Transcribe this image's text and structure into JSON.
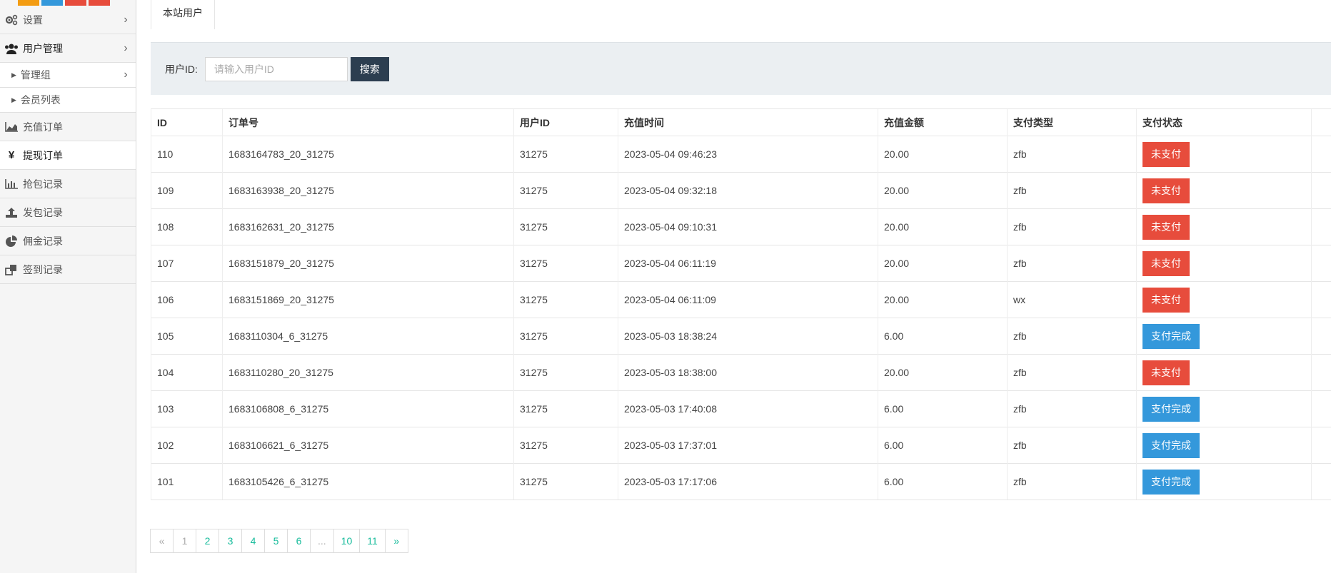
{
  "sidebar": {
    "top_colors": [
      "#f39c12",
      "#3498db",
      "#e74c3c",
      "#e74c3c"
    ],
    "items": [
      {
        "label": "设置",
        "icon": "gears-icon"
      },
      {
        "label": "用户管理",
        "icon": "users-icon"
      },
      {
        "label": "管理组"
      },
      {
        "label": "会员列表"
      },
      {
        "label": "充值订单",
        "icon": "area-chart-icon"
      },
      {
        "label": "提现订单",
        "icon": "yen-icon"
      },
      {
        "label": "抢包记录",
        "icon": "bar-chart-icon"
      },
      {
        "label": "发包记录",
        "icon": "upload-icon"
      },
      {
        "label": "佣金记录",
        "icon": "pie-chart-icon"
      },
      {
        "label": "签到记录",
        "icon": "clone-icon"
      }
    ]
  },
  "tab": {
    "label": "本站用户"
  },
  "filter": {
    "label": "用户ID:",
    "placeholder": "请输入用户ID",
    "search_label": "搜索"
  },
  "table": {
    "headers": [
      "ID",
      "订单号",
      "用户ID",
      "充值时间",
      "充值金额",
      "支付类型",
      "支付状态"
    ],
    "rows": [
      {
        "id": "110",
        "order": "1683164783_20_31275",
        "uid": "31275",
        "time": "2023-05-04 09:46:23",
        "amount": "20.00",
        "type": "zfb",
        "status": "未支付",
        "paid": false
      },
      {
        "id": "109",
        "order": "1683163938_20_31275",
        "uid": "31275",
        "time": "2023-05-04 09:32:18",
        "amount": "20.00",
        "type": "zfb",
        "status": "未支付",
        "paid": false
      },
      {
        "id": "108",
        "order": "1683162631_20_31275",
        "uid": "31275",
        "time": "2023-05-04 09:10:31",
        "amount": "20.00",
        "type": "zfb",
        "status": "未支付",
        "paid": false
      },
      {
        "id": "107",
        "order": "1683151879_20_31275",
        "uid": "31275",
        "time": "2023-05-04 06:11:19",
        "amount": "20.00",
        "type": "zfb",
        "status": "未支付",
        "paid": false
      },
      {
        "id": "106",
        "order": "1683151869_20_31275",
        "uid": "31275",
        "time": "2023-05-04 06:11:09",
        "amount": "20.00",
        "type": "wx",
        "status": "未支付",
        "paid": false
      },
      {
        "id": "105",
        "order": "1683110304_6_31275",
        "uid": "31275",
        "time": "2023-05-03 18:38:24",
        "amount": "6.00",
        "type": "zfb",
        "status": "支付完成",
        "paid": true
      },
      {
        "id": "104",
        "order": "1683110280_20_31275",
        "uid": "31275",
        "time": "2023-05-03 18:38:00",
        "amount": "20.00",
        "type": "zfb",
        "status": "未支付",
        "paid": false
      },
      {
        "id": "103",
        "order": "1683106808_6_31275",
        "uid": "31275",
        "time": "2023-05-03 17:40:08",
        "amount": "6.00",
        "type": "zfb",
        "status": "支付完成",
        "paid": true
      },
      {
        "id": "102",
        "order": "1683106621_6_31275",
        "uid": "31275",
        "time": "2023-05-03 17:37:01",
        "amount": "6.00",
        "type": "zfb",
        "status": "支付完成",
        "paid": true
      },
      {
        "id": "101",
        "order": "1683105426_6_31275",
        "uid": "31275",
        "time": "2023-05-03 17:17:06",
        "amount": "6.00",
        "type": "zfb",
        "status": "支付完成",
        "paid": true
      }
    ]
  },
  "pagination": [
    "«",
    "1",
    "2",
    "3",
    "4",
    "5",
    "6",
    "...",
    "10",
    "11",
    "»"
  ],
  "colors": {
    "unpaid": "#e74c3c",
    "paid": "#3498db",
    "search_btn": "#2c3e50",
    "page_link": "#18bc9c"
  }
}
